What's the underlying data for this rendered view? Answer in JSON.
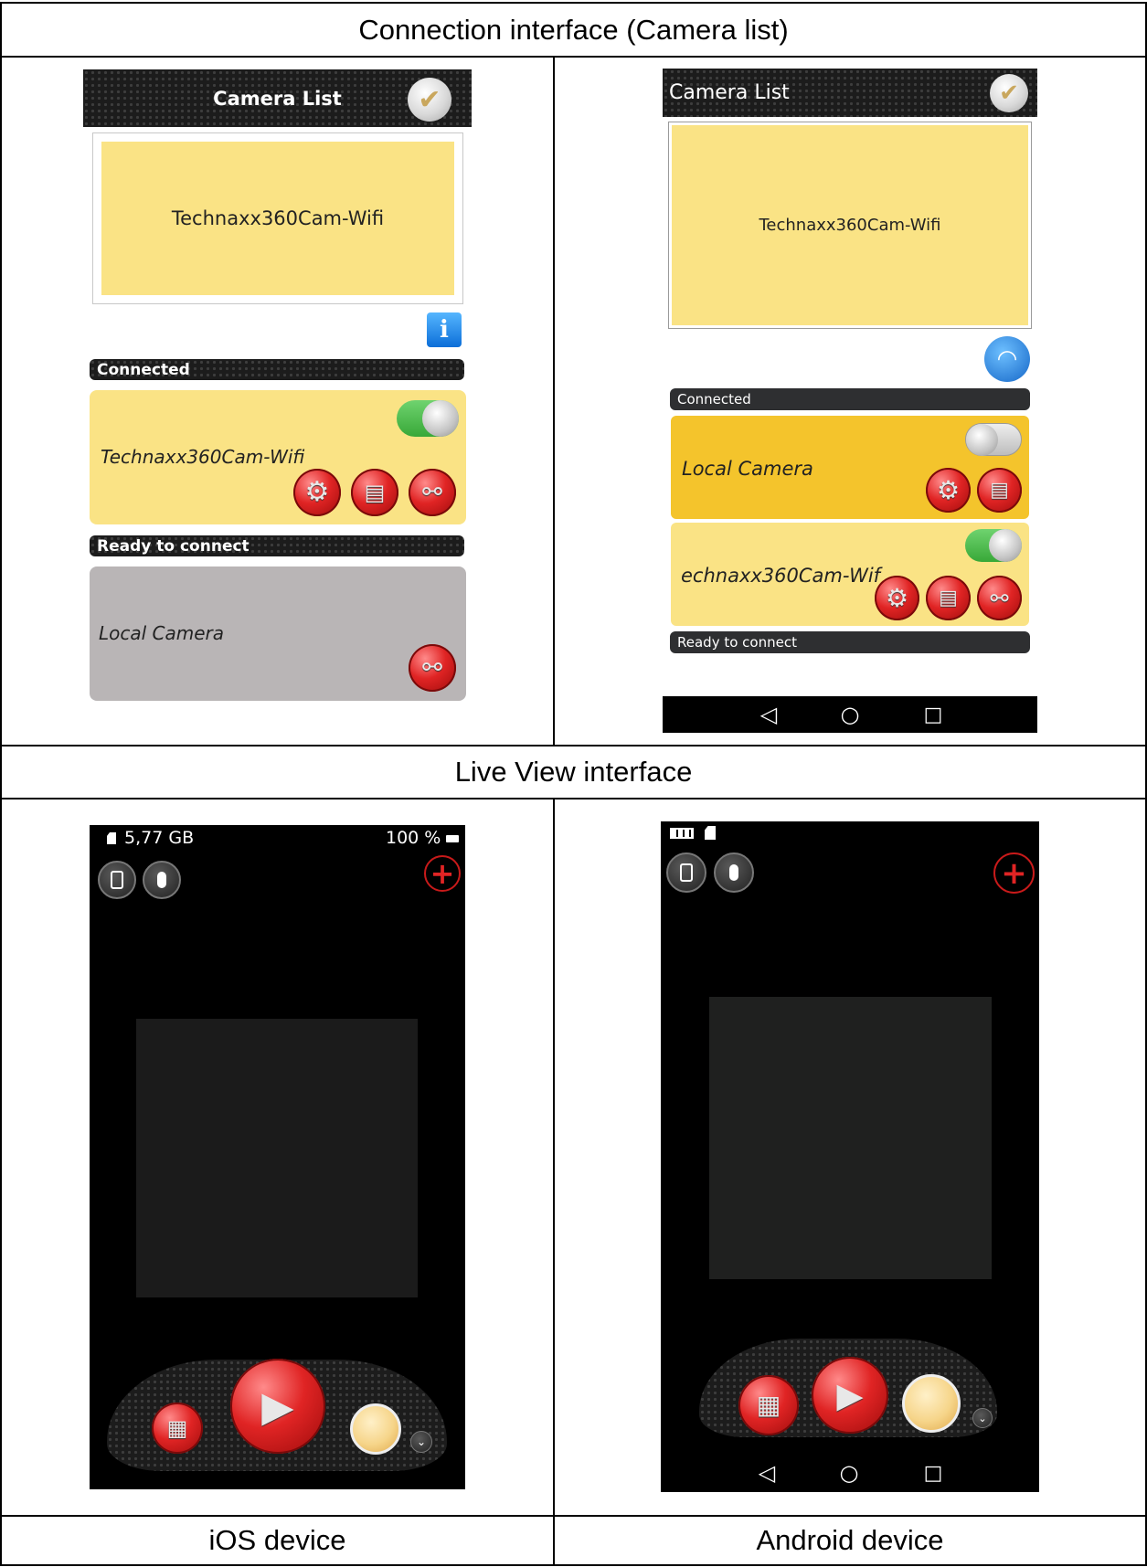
{
  "captions": {
    "connection": "Connection interface (Camera list)",
    "live_view": "Live View interface",
    "ios": "iOS device",
    "android": "Android device"
  },
  "ios_list": {
    "title": "Camera List",
    "camera_name": "Technaxx360Cam-Wifi",
    "connected_label": "Connected",
    "connected_camera": "Technaxx360Cam-Wifi",
    "ready_label": "Ready to connect",
    "local_camera": "Local Camera"
  },
  "android_list": {
    "title": "Camera List",
    "camera_name": "Technaxx360Cam-Wifi",
    "connected_label": "Connected",
    "local_camera": "Local Camera",
    "connected_camera": "echnaxx360Cam-Wif",
    "ready_label": "Ready to connect"
  },
  "ios_live": {
    "storage": "5,77 GB",
    "battery": "100 %"
  },
  "colors": {
    "card_yellow": "#fae385",
    "card_gold": "#f4c42c",
    "card_grey": "#b9b5b6",
    "record_red": "#e02424"
  },
  "icons": [
    "check-icon",
    "info-icon",
    "wifi-icon",
    "gear-icon",
    "folder-icon",
    "link-icon",
    "toggle-switch",
    "phone-camera-icon",
    "microphone-icon",
    "plus-icon",
    "gallery-icon",
    "video-camera-icon",
    "shutter-button",
    "chevron-down-icon",
    "back-icon",
    "home-icon",
    "recents-icon",
    "sd-card-icon",
    "battery-icon"
  ]
}
